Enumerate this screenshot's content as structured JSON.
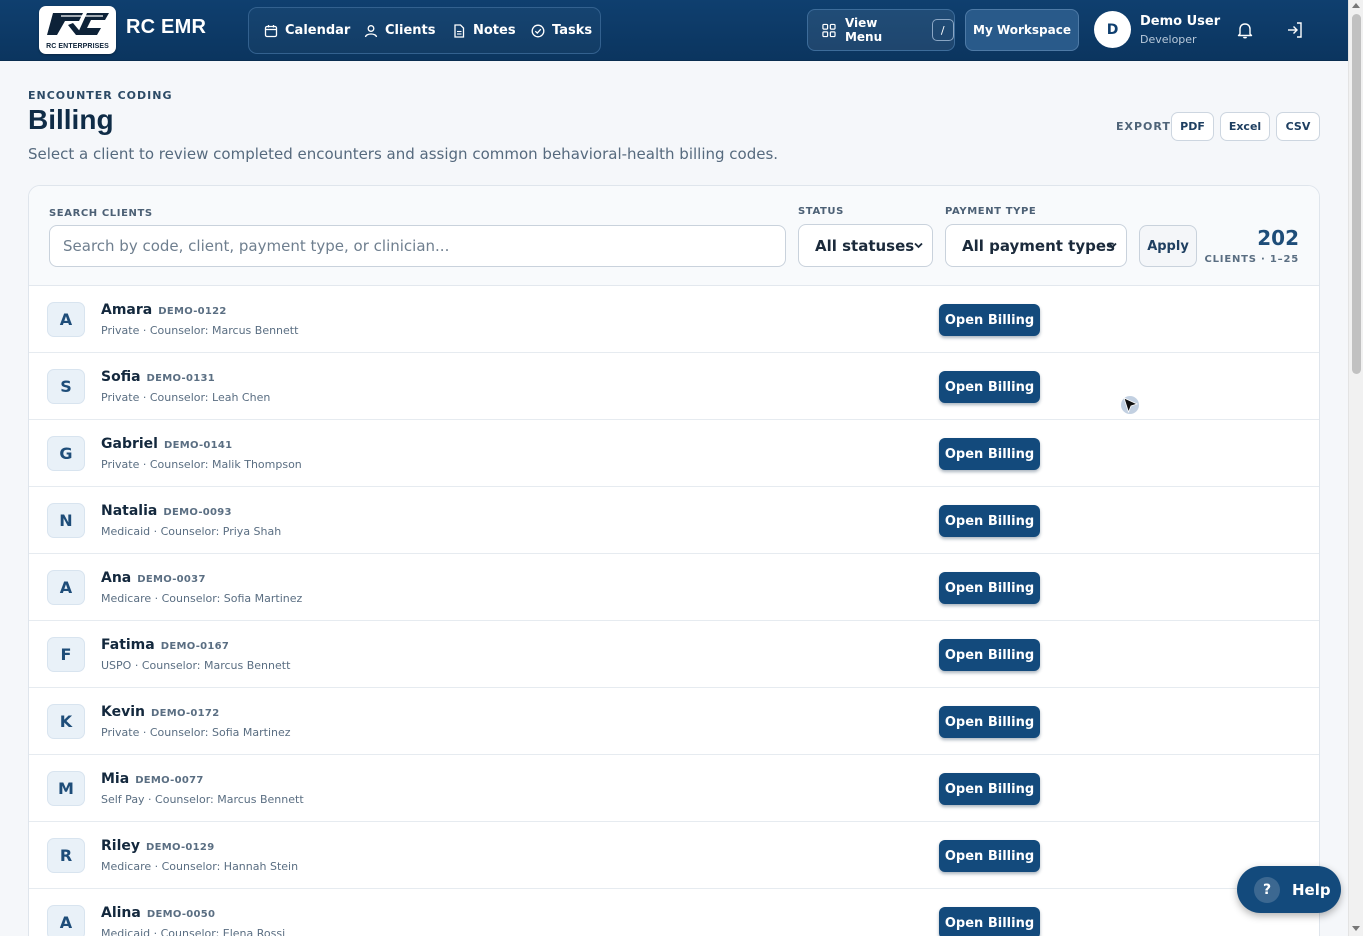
{
  "header": {
    "app_title": "RC EMR",
    "logo_text": "RC ENTERPRISES",
    "nav": [
      {
        "label": "Calendar",
        "icon": "calendar-icon"
      },
      {
        "label": "Clients",
        "icon": "user-icon"
      },
      {
        "label": "Notes",
        "icon": "document-icon"
      },
      {
        "label": "Tasks",
        "icon": "check-circle-icon"
      }
    ],
    "view_menu_label": "View Menu",
    "view_menu_shortcut": "/",
    "workspace_label": "My Workspace",
    "user": {
      "initial": "D",
      "name": "Demo User",
      "role": "Developer"
    }
  },
  "page": {
    "eyebrow": "ENCOUNTER CODING",
    "title": "Billing",
    "description": "Select a client to review completed encounters and assign common behavioral-health billing codes.",
    "export_label": "EXPORT",
    "export_buttons": [
      "PDF",
      "Excel",
      "CSV"
    ]
  },
  "filters": {
    "search_label": "SEARCH CLIENTS",
    "search_placeholder": "Search by code, client, payment type, or clinician...",
    "search_value": "",
    "status_label": "STATUS",
    "status_value": "All statuses",
    "payment_label": "PAYMENT TYPE",
    "payment_value": "All payment types",
    "apply_label": "Apply",
    "count": "202",
    "count_label": "CLIENTS · 1–25"
  },
  "clients": [
    {
      "initial": "A",
      "name": "Amara",
      "code": "DEMO-0122",
      "meta": "Private · Counselor: Marcus Bennett"
    },
    {
      "initial": "S",
      "name": "Sofia",
      "code": "DEMO-0131",
      "meta": "Private · Counselor: Leah Chen"
    },
    {
      "initial": "G",
      "name": "Gabriel",
      "code": "DEMO-0141",
      "meta": "Private · Counselor: Malik Thompson"
    },
    {
      "initial": "N",
      "name": "Natalia",
      "code": "DEMO-0093",
      "meta": "Medicaid · Counselor: Priya Shah"
    },
    {
      "initial": "A",
      "name": "Ana",
      "code": "DEMO-0037",
      "meta": "Medicare · Counselor: Sofia Martinez"
    },
    {
      "initial": "F",
      "name": "Fatima",
      "code": "DEMO-0167",
      "meta": "USPO · Counselor: Marcus Bennett"
    },
    {
      "initial": "K",
      "name": "Kevin",
      "code": "DEMO-0172",
      "meta": "Private · Counselor: Sofia Martinez"
    },
    {
      "initial": "M",
      "name": "Mia",
      "code": "DEMO-0077",
      "meta": "Self Pay · Counselor: Marcus Bennett"
    },
    {
      "initial": "R",
      "name": "Riley",
      "code": "DEMO-0129",
      "meta": "Medicare · Counselor: Hannah Stein"
    },
    {
      "initial": "A",
      "name": "Alina",
      "code": "DEMO-0050",
      "meta": "Medicaid · Counselor: Elena Rossi"
    }
  ],
  "row_action_label": "Open Billing",
  "help_label": "Help",
  "colors": {
    "header": "#0f3f6f",
    "primary_button": "#134a7c",
    "accent": "#1e4d79"
  }
}
